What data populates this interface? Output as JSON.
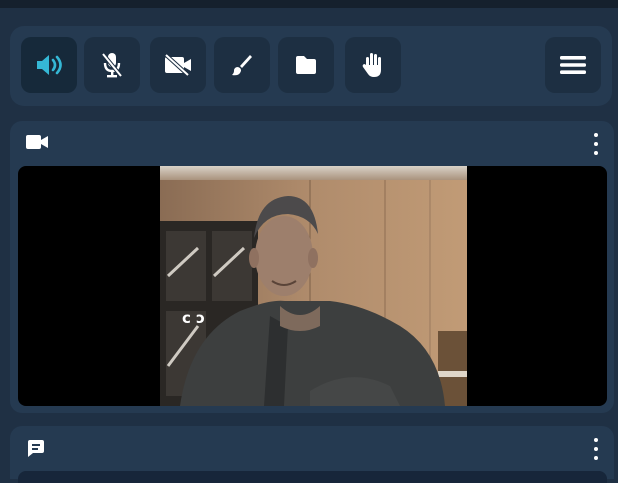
{
  "toolbar": {
    "buttons": [
      {
        "id": "speaker",
        "icon": "speaker-icon",
        "active": true
      },
      {
        "id": "microphone",
        "icon": "microphone-muted-icon",
        "active": false
      },
      {
        "id": "camera",
        "icon": "camera-off-icon",
        "active": false
      },
      {
        "id": "whiteboard",
        "icon": "brush-icon",
        "active": false
      },
      {
        "id": "files",
        "icon": "folder-icon",
        "active": false
      },
      {
        "id": "raise-hand",
        "icon": "hand-icon",
        "active": false
      }
    ],
    "menu_icon": "hamburger-menu-icon"
  },
  "video_panel": {
    "header_icon": "video-camera-icon",
    "menu_icon": "more-vertical-icon",
    "feed_overlay_text": "c ɔ"
  },
  "chat_panel": {
    "header_icon": "chat-icon",
    "menu_icon": "more-vertical-icon"
  },
  "colors": {
    "accent": "#35b8d6",
    "panel_bg": "#253a51",
    "page_bg": "#1f3044",
    "button_bg": "#1d2f42"
  }
}
